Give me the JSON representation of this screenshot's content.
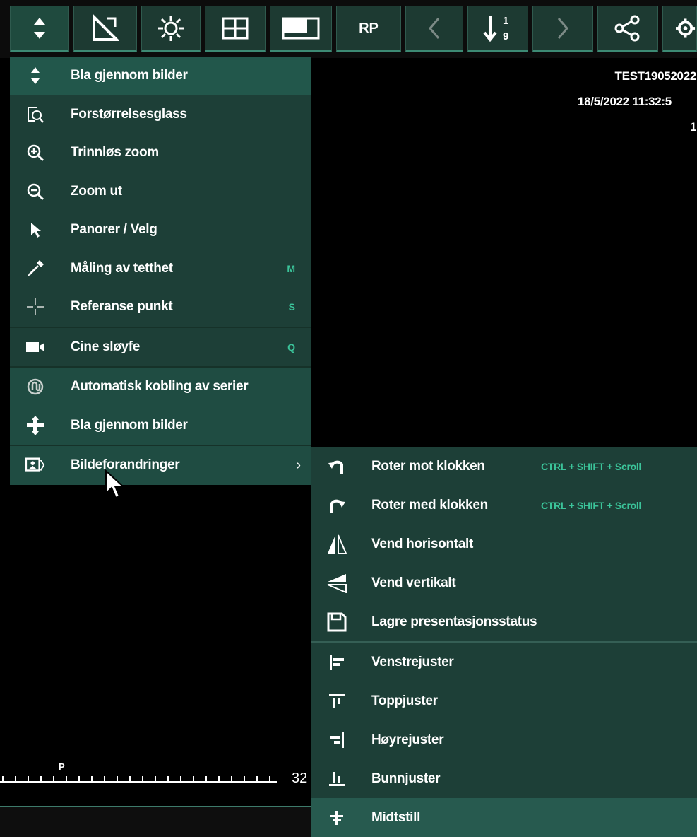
{
  "toolbar": {
    "rp_label": "RP",
    "icons": [
      "scroll-updown-icon",
      "measure-triangle-icon",
      "brightness-icon",
      "grid-layout-icon",
      "display-icon",
      "rp",
      "chevron-left-icon",
      "sort-descending-icon",
      "chevron-right-icon",
      "share-icon",
      "settings-icon"
    ]
  },
  "overlay": {
    "patient_id": "TEST19052022",
    "datetime": "18/5/2022 11:32:5",
    "number": "1",
    "ruler_value": "32",
    "ruler_marker": "P"
  },
  "menu": {
    "items": [
      {
        "label": "Bla gjennom bilder",
        "shortcut": "",
        "icon": "scroll-updown-icon"
      },
      {
        "label": "Forstørrelsesglass",
        "shortcut": "",
        "icon": "magnifier-glass-icon"
      },
      {
        "label": "Trinnløs zoom",
        "shortcut": "",
        "icon": "zoom-in-icon"
      },
      {
        "label": "Zoom ut",
        "shortcut": "",
        "icon": "zoom-out-icon"
      },
      {
        "label": "Panorer / Velg",
        "shortcut": "",
        "icon": "pointer-icon"
      },
      {
        "label": "Måling av tetthet",
        "shortcut": "M",
        "icon": "pipette-icon"
      },
      {
        "label": "Referanse punkt",
        "shortcut": "S",
        "icon": "crosshair-icon"
      },
      {
        "label": "Cine sløyfe",
        "shortcut": "Q",
        "icon": "video-camera-icon"
      },
      {
        "label": "Automatisk kobling av serier",
        "shortcut": "",
        "icon": "link-series-icon"
      },
      {
        "label": "Bla gjennom bilder",
        "shortcut": "",
        "icon": "stack-scroll-icon"
      },
      {
        "label": "Bildeforandringer",
        "shortcut": "",
        "icon": "image-transform-icon",
        "arrow": "›"
      }
    ]
  },
  "submenu": {
    "items": [
      {
        "label": "Roter mot klokken",
        "shortcut": "CTRL + SHIFT + Scroll",
        "icon": "rotate-ccw-icon"
      },
      {
        "label": "Roter med klokken",
        "shortcut": "CTRL + SHIFT + Scroll",
        "icon": "rotate-cw-icon"
      },
      {
        "label": "Vend horisontalt",
        "shortcut": "",
        "icon": "flip-horizontal-icon"
      },
      {
        "label": "Vend vertikalt",
        "shortcut": "",
        "icon": "flip-vertical-icon"
      },
      {
        "label": "Lagre presentasjonsstatus",
        "shortcut": "",
        "icon": "save-icon"
      },
      {
        "label": "Venstrejuster",
        "shortcut": "",
        "icon": "align-left-icon"
      },
      {
        "label": "Toppjuster",
        "shortcut": "",
        "icon": "align-top-icon"
      },
      {
        "label": "Høyrejuster",
        "shortcut": "",
        "icon": "align-right-icon"
      },
      {
        "label": "Bunnjuster",
        "shortcut": "",
        "icon": "align-bottom-icon"
      },
      {
        "label": "Midtstill",
        "shortcut": "",
        "icon": "align-center-icon"
      }
    ]
  },
  "colors": {
    "menu_bg": "#1d3f37",
    "highlight": "#22574b",
    "shortcut": "#3bc49a",
    "toolbar_btn": "#1d3a32"
  }
}
